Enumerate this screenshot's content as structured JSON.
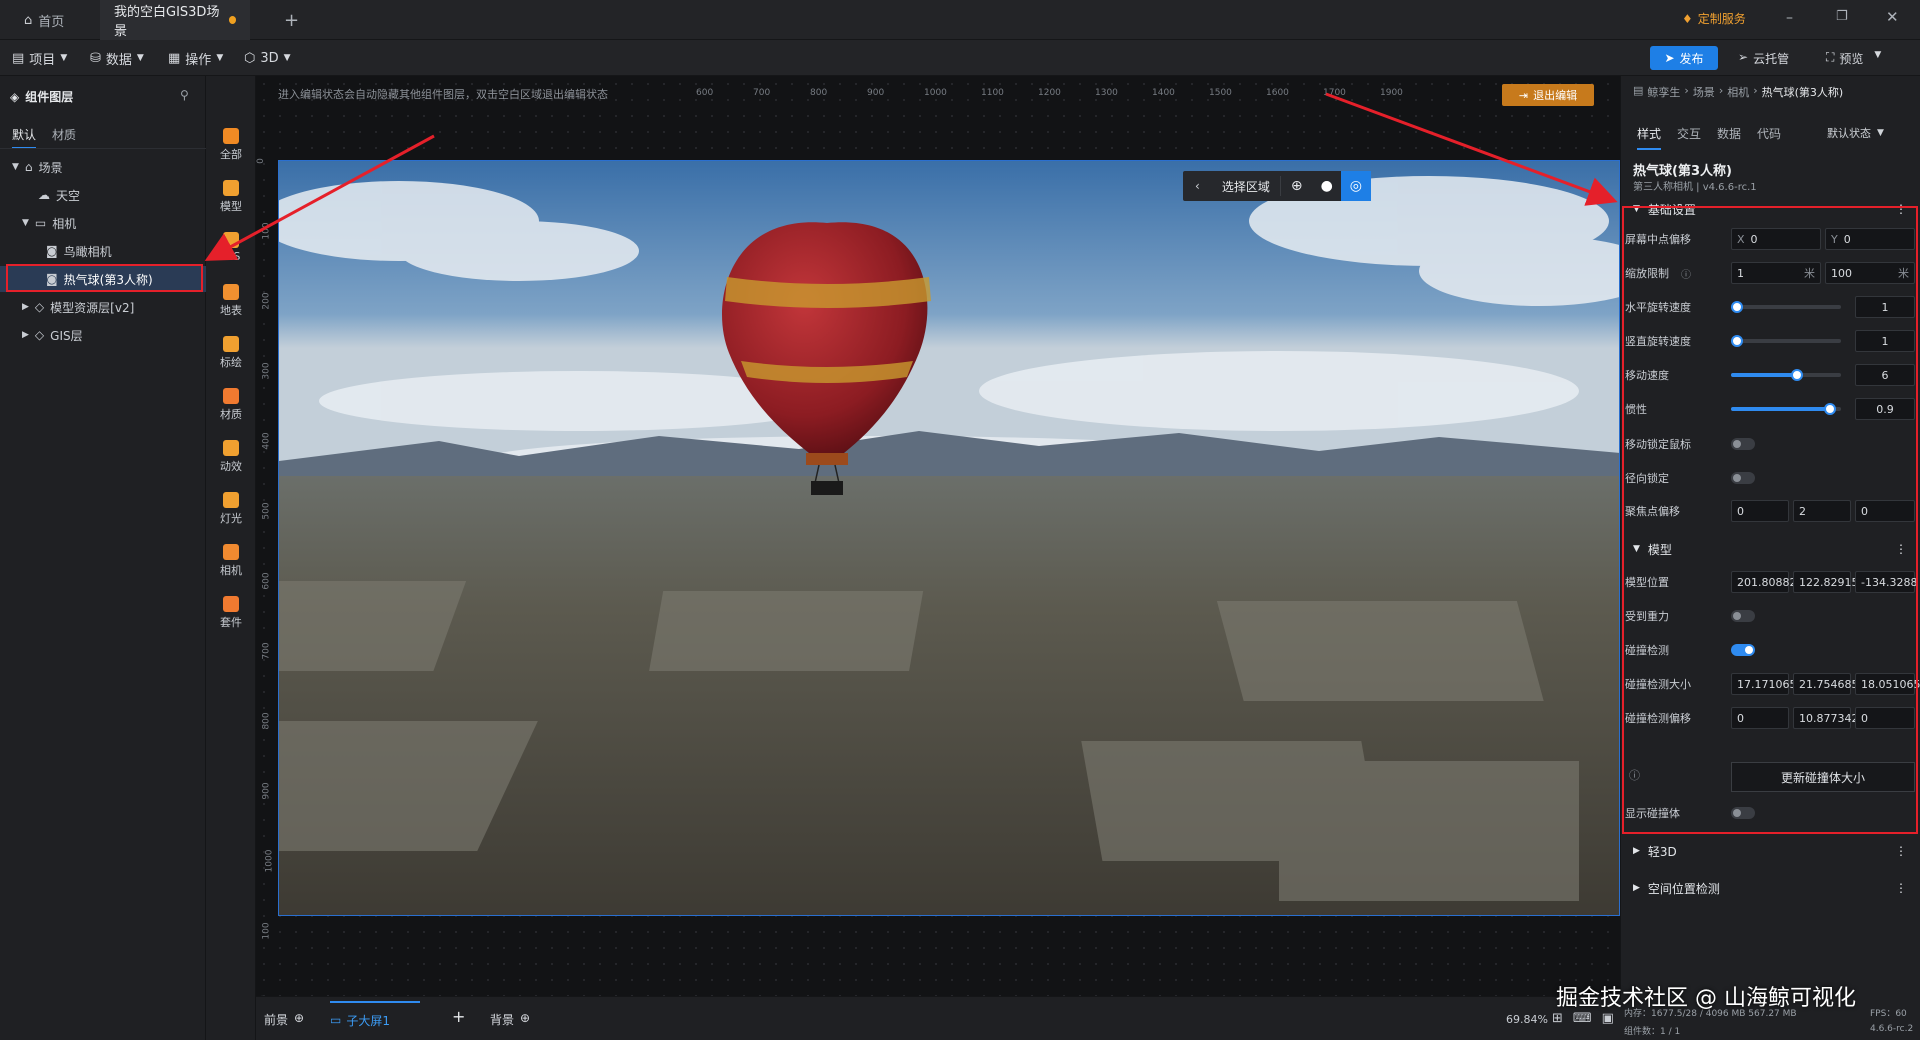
{
  "titlebar": {
    "home_label": "首页",
    "active_tab": "我的空白GIS3D场景",
    "custom_service": "定制服务"
  },
  "menubar": {
    "items": [
      {
        "label": "项目"
      },
      {
        "label": "数据"
      },
      {
        "label": "操作"
      },
      {
        "label": "3D"
      }
    ],
    "publish": "发布",
    "cloud": "云托管",
    "preview": "预览"
  },
  "leftpanel": {
    "title": "组件图层",
    "tabs": [
      "默认",
      "材质"
    ],
    "tree": [
      {
        "label": "场景"
      },
      {
        "label": "天空"
      },
      {
        "label": "相机"
      },
      {
        "label": "鸟瞰相机"
      },
      {
        "label": "热气球(第3人称)"
      },
      {
        "label": "模型资源层[v2]"
      },
      {
        "label": "GIS层"
      }
    ]
  },
  "toolstrip": {
    "tools": [
      {
        "label": "全部",
        "color": "#f08a24"
      },
      {
        "label": "模型",
        "color": "#f0a030"
      },
      {
        "label": "GIS",
        "color": "#f0a030"
      },
      {
        "label": "地表",
        "color": "#f09030"
      },
      {
        "label": "标绘",
        "color": "#f0a030"
      },
      {
        "label": "材质",
        "color": "#f07a30"
      },
      {
        "label": "动效",
        "color": "#f0a030"
      },
      {
        "label": "灯光",
        "color": "#f0a030"
      },
      {
        "label": "相机",
        "color": "#f08a30"
      },
      {
        "label": "套件",
        "color": "#f07a30"
      }
    ]
  },
  "canvas": {
    "hint": "进入编辑状态会自动隐藏其他组件图层，双击空白区域退出编辑状态",
    "exit_edit": "退出编辑",
    "select_area": "选择区域",
    "ruler_top": [
      "600",
      "700",
      "800",
      "900",
      "1000",
      "1100",
      "1200",
      "1300",
      "1400",
      "1500",
      "1600",
      "1700",
      "1900"
    ],
    "ruler_left": [
      "0",
      "100",
      "200",
      "300",
      "400",
      "500",
      "600",
      "700",
      "800",
      "900",
      "1000",
      "100",
      "00"
    ]
  },
  "rightpanel": {
    "breadcrumb": [
      "鲸孪生",
      "场景",
      "相机",
      "热气球(第3人称)"
    ],
    "tabs": [
      "样式",
      "交互",
      "数据",
      "代码"
    ],
    "state": "默认状态",
    "comp_title": "热气球(第3人称)",
    "comp_sub": "第三人称相机 | v4.6.6-rc.1",
    "sec_basic": "基础设置",
    "rows": {
      "screen_offset": {
        "label": "屏幕中点偏移",
        "x_prefix": "X",
        "x": "0",
        "y_prefix": "Y",
        "y": "0"
      },
      "zoom_limit": {
        "label": "缩放限制",
        "min": "1",
        "max": "100",
        "unit": "米"
      },
      "h_rot": {
        "label": "水平旋转速度",
        "value": "1",
        "level": 0.05
      },
      "v_rot": {
        "label": "竖直旋转速度",
        "value": "1",
        "level": 0.05
      },
      "move_speed": {
        "label": "移动速度",
        "value": "6",
        "level": 0.6
      },
      "inertia": {
        "label": "惯性",
        "value": "0.9",
        "level": 0.9
      },
      "lock_mouse": {
        "label": "移动锁定鼠标"
      },
      "radial_lock": {
        "label": "径向锁定"
      },
      "focus_offset": {
        "label": "聚焦点偏移",
        "a": "0",
        "b": "2",
        "c": "0"
      }
    },
    "sec_model": "模型",
    "model_rows": {
      "position": {
        "label": "模型位置",
        "a": "201.80882",
        "b": "122.82915:",
        "c": "-134.3288"
      },
      "gravity": {
        "label": "受到重力"
      },
      "collision": {
        "label": "碰撞检测"
      },
      "coll_size": {
        "label": "碰撞检测大小",
        "a": "17.1710653",
        "b": "21.754685",
        "c": "18.051065"
      },
      "coll_offset": {
        "label": "碰撞检测偏移",
        "a": "0",
        "b": "10.877342",
        "c": "0"
      },
      "update_btn": "更新碰撞体大小",
      "show_coll": {
        "label": "显示碰撞体"
      }
    },
    "sec_light3d": "轻3D",
    "sec_space": "空间位置检测"
  },
  "bottombar": {
    "foreground": "前景",
    "sub_screen": "子大屏1",
    "background": "背景",
    "zoom": "69.84%"
  },
  "status": {
    "line1": "内存：1677.5/28 / 4096 MB   567.27 MB",
    "fps": "FPS：60",
    "line2": "组件数：1 / 1",
    "version": "4.6.6-rc.2"
  },
  "watermark": "掘金技术社区 @ 山海鲸可视化"
}
